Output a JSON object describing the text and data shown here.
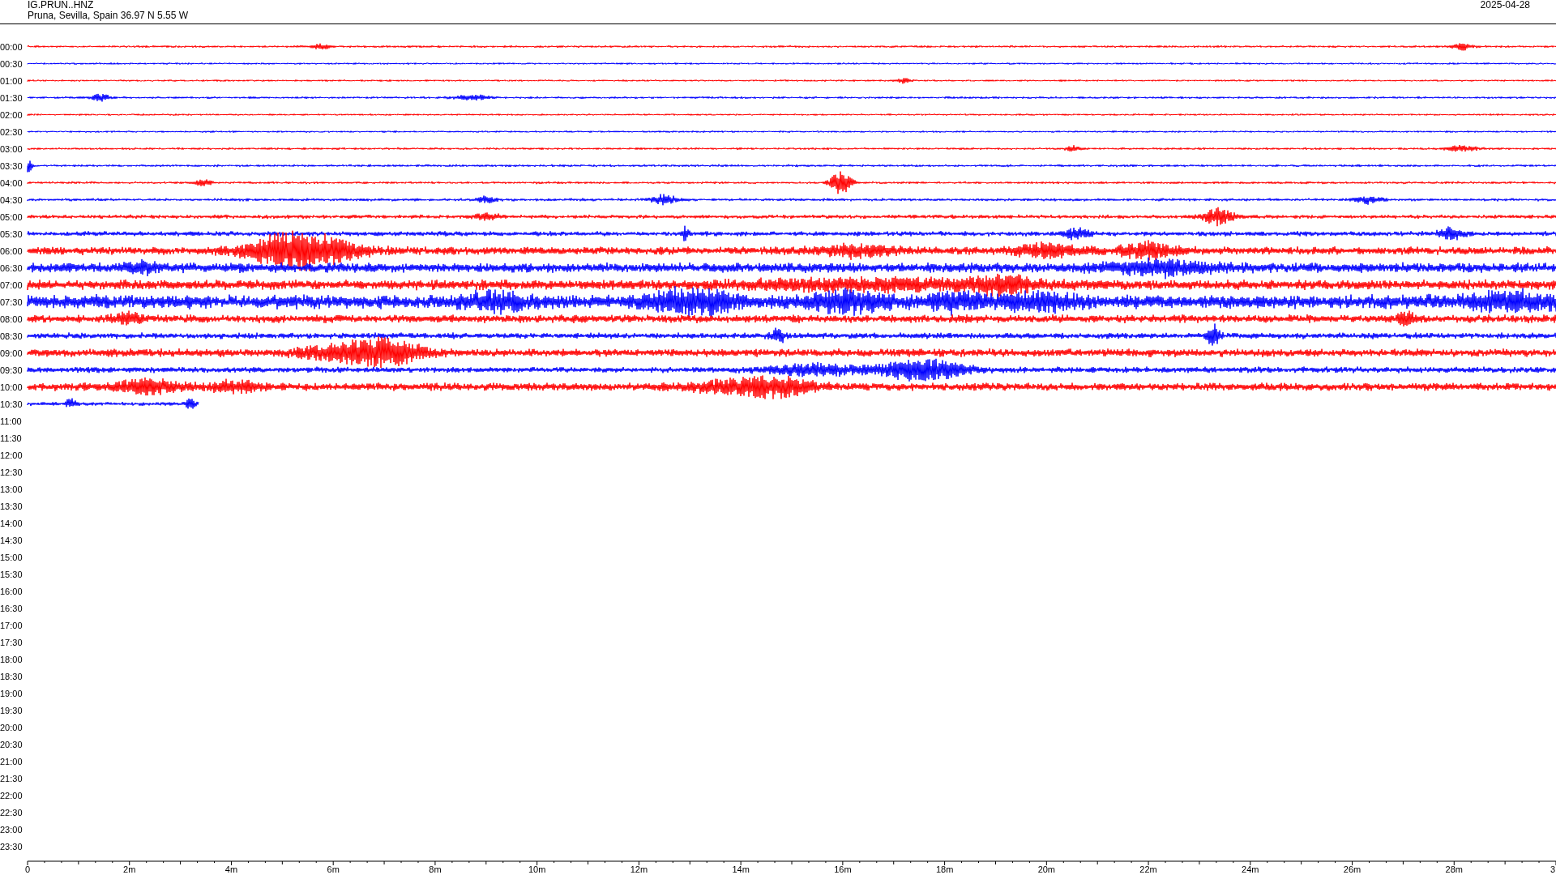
{
  "header": {
    "station": "IG.PRUN..HNZ",
    "location": "Pruna, Sevilla, Spain  36.97 N 5.55 W",
    "date": "2025-04-28"
  },
  "rows": [
    {
      "label": "00:00",
      "kind": "trace",
      "color": "#ff0000"
    },
    {
      "label": "00:30",
      "kind": "trace",
      "color": "#0000ff"
    },
    {
      "label": "01:00",
      "kind": "trace",
      "color": "#ff0000"
    },
    {
      "label": "01:30",
      "kind": "trace",
      "color": "#0000ff"
    },
    {
      "label": "02:00",
      "kind": "trace",
      "color": "#ff0000"
    },
    {
      "label": "02:30",
      "kind": "trace",
      "color": "#0000ff"
    },
    {
      "label": "03:00",
      "kind": "trace",
      "color": "#ff0000"
    },
    {
      "label": "03:30",
      "kind": "trace",
      "color": "#0000ff"
    },
    {
      "label": "04:00",
      "kind": "trace",
      "color": "#ff0000"
    },
    {
      "label": "04:30",
      "kind": "trace",
      "color": "#0000ff"
    },
    {
      "label": "05:00",
      "kind": "trace",
      "color": "#ff0000"
    },
    {
      "label": "05:30",
      "kind": "trace",
      "color": "#0000ff"
    },
    {
      "label": "06:00",
      "kind": "trace",
      "color": "#ff0000"
    },
    {
      "label": "06:30",
      "kind": "trace",
      "color": "#0000ff"
    },
    {
      "label": "07:00",
      "kind": "trace",
      "color": "#ff0000"
    },
    {
      "label": "07:30",
      "kind": "trace",
      "color": "#0000ff"
    },
    {
      "label": "08:00",
      "kind": "trace",
      "color": "#ff0000"
    },
    {
      "label": "08:30",
      "kind": "trace",
      "color": "#0000ff"
    },
    {
      "label": "09:00",
      "kind": "trace",
      "color": "#ff0000"
    },
    {
      "label": "09:30",
      "kind": "trace",
      "color": "#0000ff"
    },
    {
      "label": "10:00",
      "kind": "trace",
      "color": "#ff0000"
    },
    {
      "label": "10:30",
      "kind": "partial",
      "color": "#0000ff"
    },
    {
      "label": "11:00",
      "kind": "empty"
    },
    {
      "label": "11:30",
      "kind": "empty"
    },
    {
      "label": "12:00",
      "kind": "empty"
    },
    {
      "label": "12:30",
      "kind": "empty"
    },
    {
      "label": "13:00",
      "kind": "empty"
    },
    {
      "label": "13:30",
      "kind": "empty"
    },
    {
      "label": "14:00",
      "kind": "empty"
    },
    {
      "label": "14:30",
      "kind": "empty"
    },
    {
      "label": "15:00",
      "kind": "empty"
    },
    {
      "label": "15:30",
      "kind": "empty"
    },
    {
      "label": "16:00",
      "kind": "empty"
    },
    {
      "label": "16:30",
      "kind": "empty"
    },
    {
      "label": "17:00",
      "kind": "empty"
    },
    {
      "label": "17:30",
      "kind": "empty"
    },
    {
      "label": "18:00",
      "kind": "empty"
    },
    {
      "label": "18:30",
      "kind": "empty"
    },
    {
      "label": "19:00",
      "kind": "empty"
    },
    {
      "label": "19:30",
      "kind": "empty"
    },
    {
      "label": "20:00",
      "kind": "empty"
    },
    {
      "label": "20:30",
      "kind": "empty"
    },
    {
      "label": "21:00",
      "kind": "empty"
    },
    {
      "label": "21:30",
      "kind": "empty"
    },
    {
      "label": "22:00",
      "kind": "empty"
    },
    {
      "label": "22:30",
      "kind": "empty"
    },
    {
      "label": "23:00",
      "kind": "empty"
    },
    {
      "label": "23:30",
      "kind": "empty"
    }
  ],
  "time_axis": {
    "labels": [
      "0",
      "2m",
      "4m",
      "6m",
      "8m",
      "10m",
      "12m",
      "14m",
      "16m",
      "18m",
      "20m",
      "22m",
      "24m",
      "26m",
      "28m",
      "3"
    ]
  }
}
